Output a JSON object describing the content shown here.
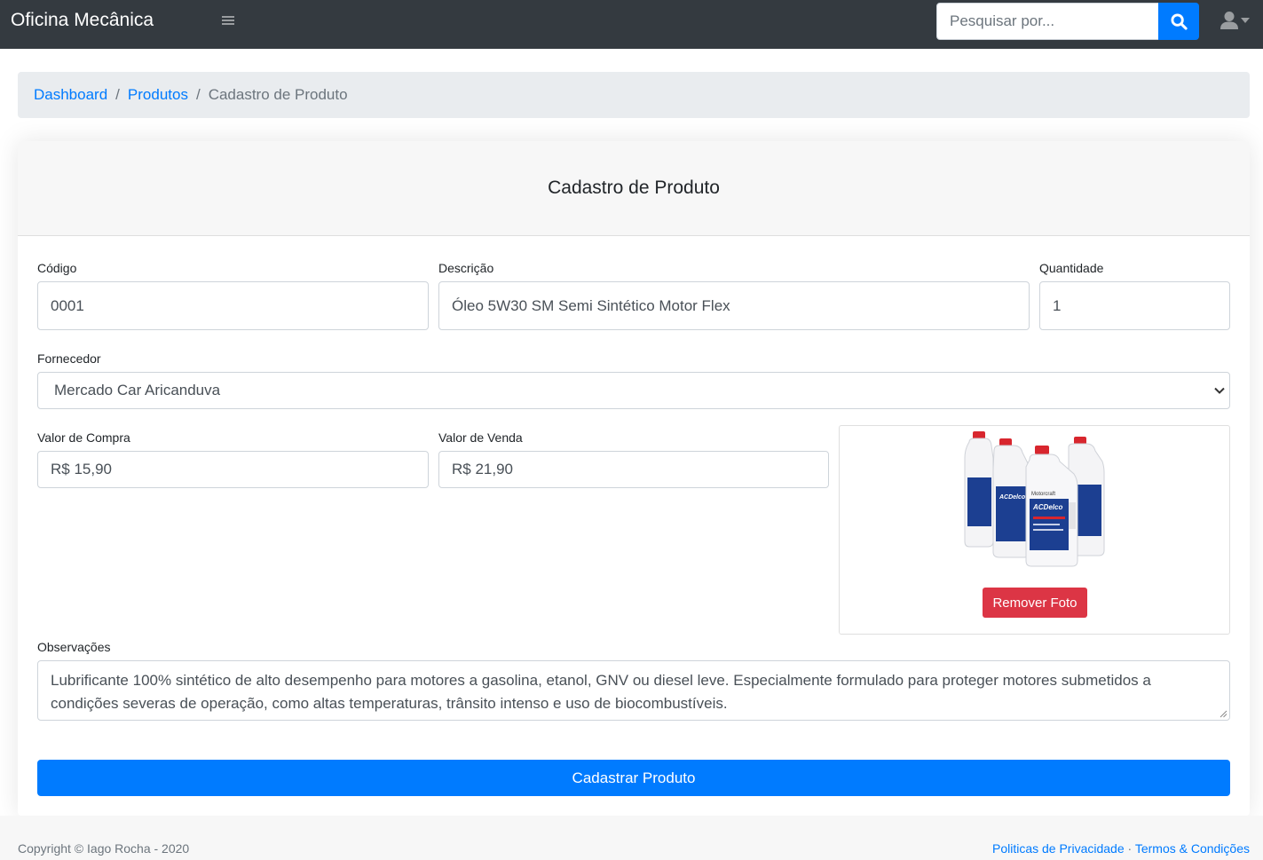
{
  "navbar": {
    "brand": "Oficina Mecânica",
    "search_placeholder": "Pesquisar por...",
    "menu_icon": "hamburger-icon",
    "search_icon": "search-icon",
    "user_icon": "user-icon"
  },
  "breadcrumb": {
    "items": [
      "Dashboard",
      "Produtos"
    ],
    "separator": "/",
    "current": "Cadastro de Produto"
  },
  "form": {
    "title": "Cadastro de Produto",
    "codigo": {
      "label": "Código",
      "value": "0001"
    },
    "descricao": {
      "label": "Descrição",
      "value": "Óleo 5W30 SM Semi Sintético Motor Flex"
    },
    "quantidade": {
      "label": "Quantidade",
      "value": "1"
    },
    "fornecedor": {
      "label": "Fornecedor",
      "selected": "Mercado Car Aricanduva"
    },
    "valor_compra": {
      "label": "Valor de Compra",
      "value": "R$ 15,90"
    },
    "valor_venda": {
      "label": "Valor de Venda",
      "value": "R$ 21,90"
    },
    "photo": {
      "remove_label": "Remover Foto",
      "bottle_labels": [
        "ACDelco",
        "Motorcraft"
      ]
    },
    "observacoes": {
      "label": "Observações",
      "value": "Lubrificante 100% sintético de alto desempenho para motores a gasolina, etanol, GNV ou diesel leve. Especialmente formulado para proteger motores submetidos a condições severas de operação, como altas temperaturas, trânsito intenso e uso de biocombustíveis."
    },
    "submit_label": "Cadastrar Produto"
  },
  "footer": {
    "copyright": "Copyright © Iago Rocha - 2020",
    "privacy_link": "Politicas de Privacidade",
    "dot": "·",
    "terms_link": "Termos & Condições"
  },
  "colors": {
    "navbar_bg": "#343a40",
    "primary": "#007bff",
    "danger": "#dc3545",
    "breadcrumb_bg": "#e9ecef"
  }
}
